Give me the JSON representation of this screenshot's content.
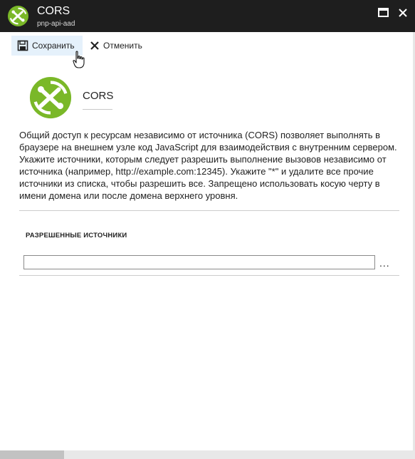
{
  "window": {
    "title": "CORS",
    "subtitle": "pnp-api-aad",
    "icon": "cors-icon",
    "accent_color": "#7ab828"
  },
  "toolbar": {
    "save_label": "Сохранить",
    "cancel_label": "Отменить"
  },
  "header": {
    "title": "CORS"
  },
  "description": "Общий доступ к ресурсам независимо от источника (CORS) позволяет выполнять в браузере на внешнем узле код JavaScript для взаимодействия с внутренним сервером. Укажите источники, которым следует разрешить выполнение вызовов независимо от источника (например, http://example.com:12345). Укажите \"*\" и удалите все прочие источники из списка, чтобы разрешить все. Запрещено использовать косую черту в имени домена или после домена верхнего уровня.",
  "origins": {
    "label": "РАЗРЕШЕННЫЕ ИСТОЧНИКИ",
    "value": "",
    "placeholder": "",
    "more_label": "..."
  }
}
